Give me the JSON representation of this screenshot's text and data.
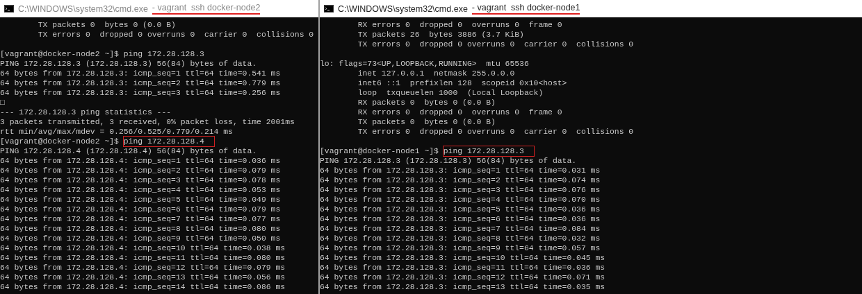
{
  "windows": [
    {
      "title": {
        "path": "C:\\WINDOWS\\system32\\cmd.exe",
        "session": "- vagrant  ssh docker-node2",
        "underlined": true
      },
      "active": false,
      "lines": [
        {
          "kind": "output",
          "text": "        TX packets 0  bytes 0 (0.0 B)"
        },
        {
          "kind": "output",
          "text": "        TX errors 0  dropped 0 overruns 0  carrier 0  collisions 0"
        },
        {
          "kind": "blank"
        },
        {
          "kind": "prompt",
          "prompt": "[vagrant@docker-node2 ~]$ ",
          "command": "ping 172.28.128.3",
          "boxed": false
        },
        {
          "kind": "output",
          "text": "PING 172.28.128.3 (172.28.128.3) 56(84) bytes of data."
        },
        {
          "kind": "output",
          "text": "64 bytes from 172.28.128.3: icmp_seq=1 ttl=64 time=0.541 ms"
        },
        {
          "kind": "output",
          "text": "64 bytes from 172.28.128.3: icmp_seq=2 ttl=64 time=0.779 ms"
        },
        {
          "kind": "output",
          "text": "64 bytes from 172.28.128.3: icmp_seq=3 ttl=64 time=0.256 ms"
        },
        {
          "kind": "output",
          "text": "□"
        },
        {
          "kind": "output",
          "text": "--- 172.28.128.3 ping statistics ---"
        },
        {
          "kind": "output",
          "text": "3 packets transmitted, 3 received, 0% packet loss, time 2001ms"
        },
        {
          "kind": "output",
          "text": "rtt min/avg/max/mdev = 0.256/0.525/0.779/0.214 ms"
        },
        {
          "kind": "prompt",
          "prompt": "[vagrant@docker-node2 ~]$ ",
          "command": "ping 172.28.128.4",
          "boxed": true
        },
        {
          "kind": "output",
          "text": "PING 172.28.128.4 (172.28.128.4) 56(84) bytes of data."
        },
        {
          "kind": "output",
          "text": "64 bytes from 172.28.128.4: icmp_seq=1 ttl=64 time=0.036 ms"
        },
        {
          "kind": "output",
          "text": "64 bytes from 172.28.128.4: icmp_seq=2 ttl=64 time=0.079 ms"
        },
        {
          "kind": "output",
          "text": "64 bytes from 172.28.128.4: icmp_seq=3 ttl=64 time=0.078 ms"
        },
        {
          "kind": "output",
          "text": "64 bytes from 172.28.128.4: icmp_seq=4 ttl=64 time=0.053 ms"
        },
        {
          "kind": "output",
          "text": "64 bytes from 172.28.128.4: icmp_seq=5 ttl=64 time=0.049 ms"
        },
        {
          "kind": "output",
          "text": "64 bytes from 172.28.128.4: icmp_seq=6 ttl=64 time=0.079 ms"
        },
        {
          "kind": "output",
          "text": "64 bytes from 172.28.128.4: icmp_seq=7 ttl=64 time=0.077 ms"
        },
        {
          "kind": "output",
          "text": "64 bytes from 172.28.128.4: icmp_seq=8 ttl=64 time=0.080 ms"
        },
        {
          "kind": "output",
          "text": "64 bytes from 172.28.128.4: icmp_seq=9 ttl=64 time=0.050 ms"
        },
        {
          "kind": "output",
          "text": "64 bytes from 172.28.128.4: icmp_seq=10 ttl=64 time=0.038 ms"
        },
        {
          "kind": "output",
          "text": "64 bytes from 172.28.128.4: icmp_seq=11 ttl=64 time=0.080 ms"
        },
        {
          "kind": "output",
          "text": "64 bytes from 172.28.128.4: icmp_seq=12 ttl=64 time=0.079 ms"
        },
        {
          "kind": "output",
          "text": "64 bytes from 172.28.128.4: icmp_seq=13 ttl=64 time=0.056 ms"
        },
        {
          "kind": "output",
          "text": "64 bytes from 172.28.128.4: icmp_seq=14 ttl=64 time=0.086 ms"
        }
      ]
    },
    {
      "title": {
        "path": "C:\\WINDOWS\\system32\\cmd.exe",
        "session": "- vagrant  ssh docker-node1",
        "underlined": true
      },
      "active": true,
      "lines": [
        {
          "kind": "output",
          "text": "        RX errors 0  dropped 0  overruns 0  frame 0"
        },
        {
          "kind": "output",
          "text": "        TX packets 26  bytes 3886 (3.7 KiB)"
        },
        {
          "kind": "output",
          "text": "        TX errors 0  dropped 0 overruns 0  carrier 0  collisions 0"
        },
        {
          "kind": "blank"
        },
        {
          "kind": "output",
          "text": "lo: flags=73<UP,LOOPBACK,RUNNING>  mtu 65536"
        },
        {
          "kind": "output",
          "text": "        inet 127.0.0.1  netmask 255.0.0.0"
        },
        {
          "kind": "output",
          "text": "        inet6 ::1  prefixlen 128  scopeid 0x10<host>"
        },
        {
          "kind": "output",
          "text": "        loop  txqueuelen 1000  (Local Loopback)"
        },
        {
          "kind": "output",
          "text": "        RX packets 0  bytes 0 (0.0 B)"
        },
        {
          "kind": "output",
          "text": "        RX errors 0  dropped 0  overruns 0  frame 0"
        },
        {
          "kind": "output",
          "text": "        TX packets 0  bytes 0 (0.0 B)"
        },
        {
          "kind": "output",
          "text": "        TX errors 0  dropped 0 overruns 0  carrier 0  collisions 0"
        },
        {
          "kind": "blank"
        },
        {
          "kind": "prompt",
          "prompt": "[vagrant@docker-node1 ~]$ ",
          "command": "ping 172.28.128.3",
          "boxed": true
        },
        {
          "kind": "output",
          "text": "PING 172.28.128.3 (172.28.128.3) 56(84) bytes of data."
        },
        {
          "kind": "output",
          "text": "64 bytes from 172.28.128.3: icmp_seq=1 ttl=64 time=0.031 ms"
        },
        {
          "kind": "output",
          "text": "64 bytes from 172.28.128.3: icmp_seq=2 ttl=64 time=0.074 ms"
        },
        {
          "kind": "output",
          "text": "64 bytes from 172.28.128.3: icmp_seq=3 ttl=64 time=0.076 ms"
        },
        {
          "kind": "output",
          "text": "64 bytes from 172.28.128.3: icmp_seq=4 ttl=64 time=0.070 ms"
        },
        {
          "kind": "output",
          "text": "64 bytes from 172.28.128.3: icmp_seq=5 ttl=64 time=0.036 ms"
        },
        {
          "kind": "output",
          "text": "64 bytes from 172.28.128.3: icmp_seq=6 ttl=64 time=0.036 ms"
        },
        {
          "kind": "output",
          "text": "64 bytes from 172.28.128.3: icmp_seq=7 ttl=64 time=0.084 ms"
        },
        {
          "kind": "output",
          "text": "64 bytes from 172.28.128.3: icmp_seq=8 ttl=64 time=0.032 ms"
        },
        {
          "kind": "output",
          "text": "64 bytes from 172.28.128.3: icmp_seq=9 ttl=64 time=0.057 ms"
        },
        {
          "kind": "output",
          "text": "64 bytes from 172.28.128.3: icmp_seq=10 ttl=64 time=0.045 ms"
        },
        {
          "kind": "output",
          "text": "64 bytes from 172.28.128.3: icmp_seq=11 ttl=64 time=0.036 ms"
        },
        {
          "kind": "output",
          "text": "64 bytes from 172.28.128.3: icmp_seq=12 ttl=64 time=0.071 ms"
        },
        {
          "kind": "output",
          "text": "64 bytes from 172.28.128.3: icmp_seq=13 ttl=64 time=0.035 ms"
        }
      ]
    }
  ]
}
